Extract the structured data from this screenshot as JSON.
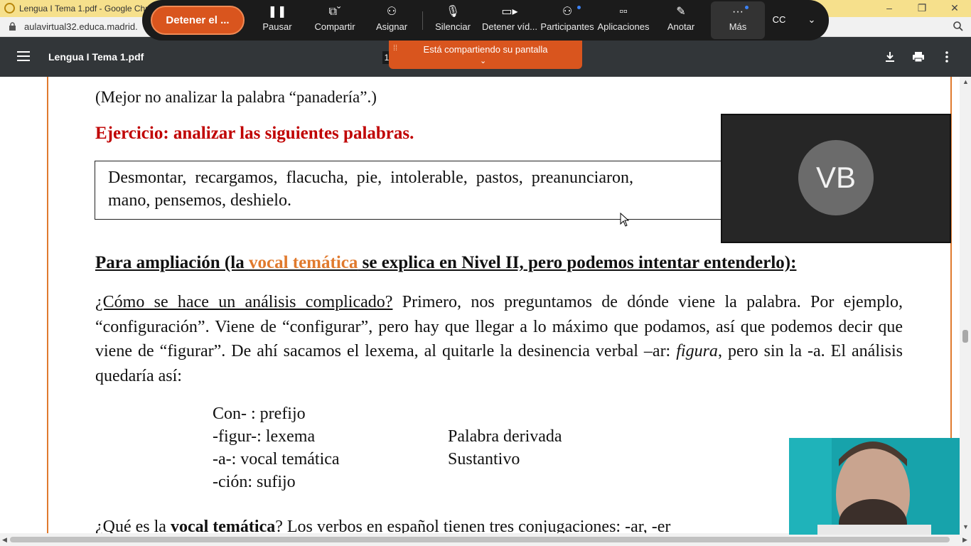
{
  "browser": {
    "tab_title": "Lengua I Tema 1.pdf - Google Chr",
    "url": "aulavirtual32.educa.madrid."
  },
  "meeting_toolbar": {
    "stop_share_label": "Detener el ...",
    "buttons": [
      {
        "label": "Pausar",
        "icon": "pause-icon"
      },
      {
        "label": "Compartir",
        "icon": "share-screen-icon"
      },
      {
        "label": "Asignar",
        "icon": "assign-icon"
      },
      {
        "label": "Silenciar",
        "icon": "microphone-icon"
      },
      {
        "label": "Detener víd...",
        "icon": "video-camera-icon"
      },
      {
        "label": "Participantes",
        "icon": "participants-icon"
      },
      {
        "label": "Aplicaciones",
        "icon": "apps-icon"
      },
      {
        "label": "Anotar",
        "icon": "annotate-icon"
      },
      {
        "label": "Más",
        "icon": "more-icon"
      }
    ],
    "banner_text": "Está compartiendo su pantalla"
  },
  "pdf_viewer": {
    "title": "Lengua I Tema 1.pdf",
    "page_number": "1"
  },
  "document": {
    "line1": "(Mejor no analizar la palabra “panadería”.)",
    "exercise_heading": "Ejercicio: analizar las siguientes palabras.",
    "box_line1": "Desmontar, recargamos, flacucha, pie, intolerable, pastos, preanunciaron,",
    "box_line2": "mano, pensemos, deshielo.",
    "ampl_part1": "Para ampliación (la ",
    "ampl_link": "vocal temática",
    "ampl_part2": " se explica en Nivel II, pero podemos intentar entenderlo):",
    "para_underlined": "¿Cómo se hace un análisis complicado?",
    "para_rest": " Primero, nos preguntamos de dónde viene la palabra. Por ejemplo, “configuración”. Viene de “configurar”, pero hay que llegar a lo máximo que podamos, así que podemos decir que viene de “figurar”. De ahí sacamos el lexema, al quitarle la desinencia verbal –ar: ",
    "para_italic": "figura",
    "para_end": ", pero sin la -a. El análisis quedaría así:",
    "analysis": [
      "Con- : prefijo",
      "-figur-: lexema",
      "-a-: vocal temática",
      "-ción: sufijo"
    ],
    "classification": [
      "Palabra derivada",
      "Sustantivo"
    ],
    "cut_part1": "¿Qué es la ",
    "cut_bold": "vocal temática",
    "cut_part2": "? Los verbos en español tienen tres conjugaciones: -ar, -er"
  },
  "participants": {
    "avatar_initials": "VB"
  },
  "colors": {
    "accent_orange": "#d9551e",
    "heading_red": "#c00000",
    "link_orange": "#e07a2e",
    "viewer_header": "#323639"
  }
}
